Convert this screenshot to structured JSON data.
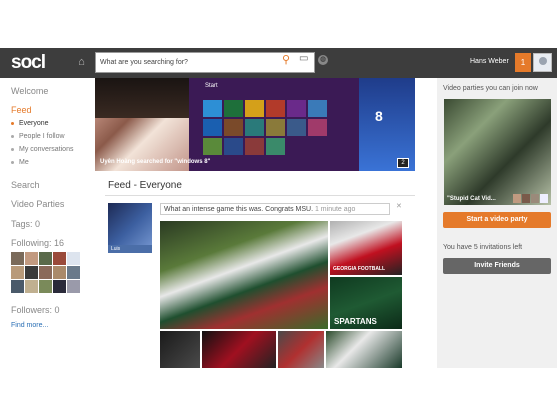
{
  "header": {
    "logo": "socl",
    "search_placeholder": "What are you searching for?",
    "username": "Hans Weber",
    "notification_count": "1"
  },
  "sidebar": {
    "welcome": "Welcome",
    "feed": "Feed",
    "feed_items": [
      "Everyone",
      "People I follow",
      "My conversations",
      "Me"
    ],
    "search": "Search",
    "video_parties": "Video Parties",
    "tags": "Tags: 0",
    "following": "Following: 16",
    "followers": "Followers: 0",
    "find_more": "Find more..."
  },
  "banner": {
    "caption": "Uyên Hoàng searched for \"windows 8\"",
    "count": "2",
    "start_label": "Start",
    "win_label": "8"
  },
  "feed": {
    "title": "Feed - Everyone",
    "post": {
      "author": "Luis",
      "text": "What an intense game this was. Congrats MSU.",
      "time": "1 minute ago"
    },
    "photo_labels": {
      "georgia": "GEORGIA FOOTBALL",
      "spartans": "SPARTANS"
    }
  },
  "right_panel": {
    "title": "Video parties you can join now",
    "video_caption": "\"Stupid Cat Vid...",
    "start_button": "Start a video party",
    "invites_text": "You have 5 invitations left",
    "invite_button": "Invite Friends"
  },
  "colors": {
    "accent": "#e57a2a",
    "header_bg": "#3d3d3d",
    "link": "#2a6fb5"
  }
}
